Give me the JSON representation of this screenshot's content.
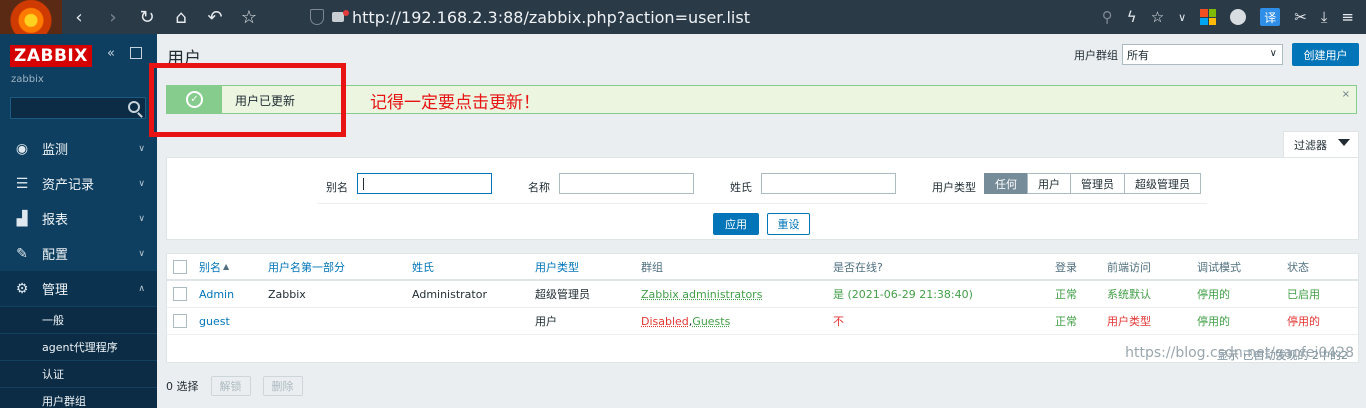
{
  "browser": {
    "url": "http://192.168.2.3:88/zabbix.php?action=user.list",
    "translate_label": "译",
    "icons": [
      "back-icon",
      "forward-icon",
      "reload-icon",
      "home-icon",
      "undo-icon",
      "star-icon",
      "shield-icon",
      "lock-icon",
      "search-icon",
      "bolt-icon",
      "star-icon",
      "chevron-down-icon",
      "apps-icon",
      "globe-icon",
      "translate-icon",
      "scissors-icon",
      "download-icon",
      "menu-icon"
    ]
  },
  "sidebar": {
    "logo": "ZABBIX",
    "server": "zabbix",
    "search_placeholder": "",
    "menu": [
      {
        "label": "监测",
        "icon": "eye-icon"
      },
      {
        "label": "资产记录",
        "icon": "list-icon"
      },
      {
        "label": "报表",
        "icon": "bar-chart-icon"
      },
      {
        "label": "配置",
        "icon": "wrench-icon"
      },
      {
        "label": "管理",
        "icon": "gear-icon"
      }
    ],
    "submenu": [
      "一般",
      "agent代理程序",
      "认证",
      "用户群组"
    ]
  },
  "header": {
    "title": "用户",
    "group_label": "用户群组",
    "group_value": "所有",
    "create_label": "创建用户"
  },
  "message": {
    "text": "用户已更新",
    "close": "×"
  },
  "annotation": "记得一定要点击更新！",
  "filter": {
    "tab_label": "过滤器",
    "alias_label": "别名",
    "name_label": "名称",
    "surname_label": "姓氏",
    "type_label": "用户类型",
    "type_options": [
      "任何",
      "用户",
      "管理员",
      "超级管理员"
    ],
    "apply": "应用",
    "reset": "重设"
  },
  "table": {
    "headers": [
      "别名",
      "用户名第一部分",
      "姓氏",
      "用户类型",
      "群组",
      "是否在线?",
      "登录",
      "前端访问",
      "调试模式",
      "状态"
    ],
    "sort_arrow": "▲",
    "rows": [
      {
        "alias": "Admin",
        "name": "Zabbix",
        "surname": "Administrator",
        "type": "超级管理员",
        "groups": "Zabbix administrators",
        "online": "是 (2021-06-29 21:38:40)",
        "login": "正常",
        "frontend": "系统默认",
        "debug": "停用的",
        "status": "已启用"
      },
      {
        "alias": "guest",
        "name": "",
        "surname": "",
        "type": "用户",
        "groups_a": "Disabled",
        "groups_sep": ", ",
        "groups_b": "Guests",
        "online": "不",
        "login": "正常",
        "frontend": "用户类型",
        "debug": "停用的",
        "status": "停用的"
      }
    ],
    "footer": "显示 已自动发现的 2中的2"
  },
  "actions": {
    "selected": "0 选择",
    "unlock": "解锁",
    "delete": "删除"
  },
  "watermark": "https://blog.csdn.net/gaofei0428",
  "colors": {
    "accent": "#0275b8",
    "logo_red": "#d40000",
    "success": "#86cc8c",
    "annotation": "#e81313",
    "ok_green": "#429e47",
    "bad_red": "#e33734"
  }
}
